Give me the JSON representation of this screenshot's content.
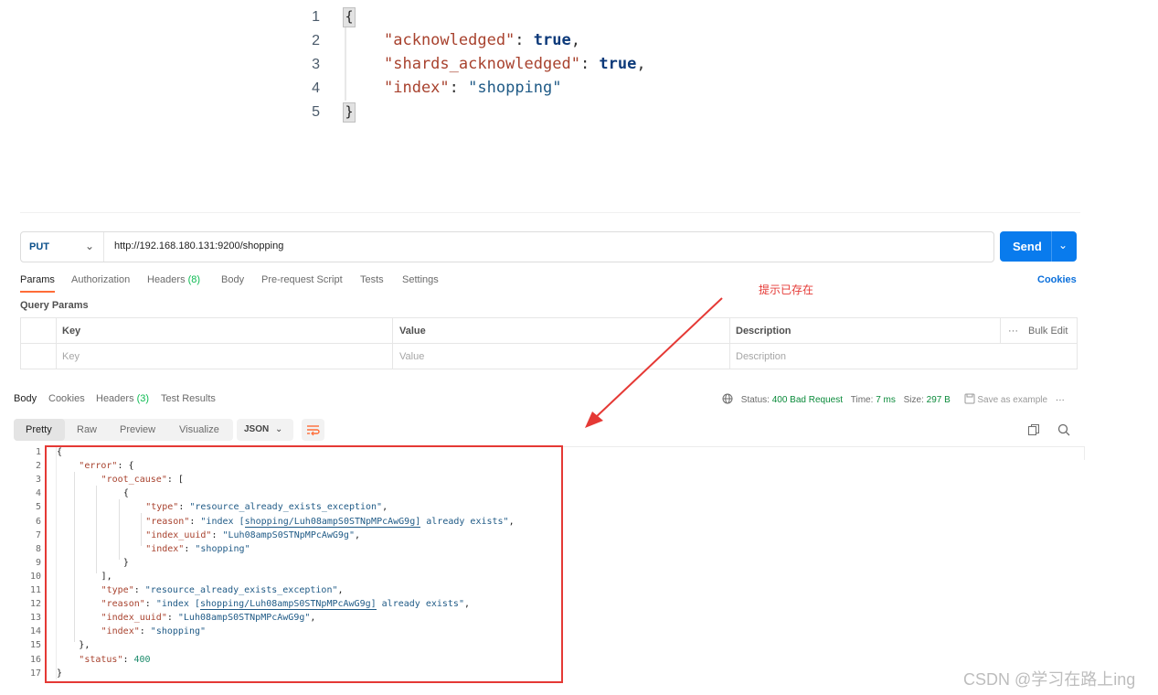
{
  "snippet": {
    "line_numbers": [
      "1",
      "2",
      "3",
      "4",
      "5"
    ],
    "open_brace": "{",
    "close_brace": "}",
    "lines": [
      {
        "key": "\"acknowledged\"",
        "sep": ": ",
        "value": "true",
        "tail": ","
      },
      {
        "key": "\"shards_acknowledged\"",
        "sep": ": ",
        "value": "true",
        "tail": ","
      },
      {
        "key": "\"index\"",
        "sep": ": ",
        "value": "\"shopping\"",
        "tail": ""
      }
    ]
  },
  "request": {
    "method": "PUT",
    "url": "http://192.168.180.131:9200/shopping",
    "send_label": "Send",
    "tabs": [
      "Params",
      "Authorization",
      "Headers",
      "(8)",
      "Body",
      "Pre-request Script",
      "Tests",
      "Settings"
    ],
    "cookies_label": "Cookies",
    "query_params_title": "Query Params",
    "table": {
      "headers": [
        "Key",
        "Value",
        "Description"
      ],
      "bulk_edit": "Bulk Edit",
      "placeholders": [
        "Key",
        "Value",
        "Description"
      ]
    }
  },
  "annotation": "提示已存在",
  "response": {
    "tabs": [
      "Body",
      "Cookies",
      "Headers",
      "(3)",
      "Test Results"
    ],
    "status_label": "Status:",
    "status_value": "400 Bad Request",
    "time_label": "Time:",
    "time_value": "7 ms",
    "size_label": "Size:",
    "size_value": "297 B",
    "save_example": "Save as example",
    "view_tabs": [
      "Pretty",
      "Raw",
      "Preview",
      "Visualize"
    ],
    "format": "JSON",
    "line_numbers": [
      "1",
      "2",
      "3",
      "4",
      "5",
      "6",
      "7",
      "8",
      "9",
      "10",
      "11",
      "12",
      "13",
      "14",
      "15",
      "16",
      "17"
    ],
    "code_lines": [
      [
        {
          "c": "p",
          "t": "{"
        }
      ],
      [
        {
          "c": "key",
          "t": "\"error\""
        },
        {
          "c": "p",
          "t": ": {"
        }
      ],
      [
        {
          "c": "key",
          "t": "\"root_cause\""
        },
        {
          "c": "p",
          "t": ": ["
        }
      ],
      [
        {
          "c": "p",
          "t": "{"
        }
      ],
      [
        {
          "c": "key",
          "t": "\"type\""
        },
        {
          "c": "p",
          "t": ": "
        },
        {
          "c": "str",
          "t": "\"resource_already_exists_exception\""
        },
        {
          "c": "p",
          "t": ","
        }
      ],
      [
        {
          "c": "key",
          "t": "\"reason\""
        },
        {
          "c": "p",
          "t": ": "
        },
        {
          "c": "str",
          "t": "\"index ["
        },
        {
          "c": "str ul",
          "t": "shopping/Luh08ampS0STNpMPcAwG9g]"
        },
        {
          "c": "str",
          "t": " already exists\""
        },
        {
          "c": "p",
          "t": ","
        }
      ],
      [
        {
          "c": "key",
          "t": "\"index_uuid\""
        },
        {
          "c": "p",
          "t": ": "
        },
        {
          "c": "str",
          "t": "\"Luh08ampS0STNpMPcAwG9g\""
        },
        {
          "c": "p",
          "t": ","
        }
      ],
      [
        {
          "c": "key",
          "t": "\"index\""
        },
        {
          "c": "p",
          "t": ": "
        },
        {
          "c": "str",
          "t": "\"shopping\""
        }
      ],
      [
        {
          "c": "p",
          "t": "}"
        }
      ],
      [
        {
          "c": "p",
          "t": "],"
        }
      ],
      [
        {
          "c": "key",
          "t": "\"type\""
        },
        {
          "c": "p",
          "t": ": "
        },
        {
          "c": "str",
          "t": "\"resource_already_exists_exception\""
        },
        {
          "c": "p",
          "t": ","
        }
      ],
      [
        {
          "c": "key",
          "t": "\"reason\""
        },
        {
          "c": "p",
          "t": ": "
        },
        {
          "c": "str",
          "t": "\"index ["
        },
        {
          "c": "str ul",
          "t": "shopping/Luh08ampS0STNpMPcAwG9g]"
        },
        {
          "c": "str",
          "t": " already exists\""
        },
        {
          "c": "p",
          "t": ","
        }
      ],
      [
        {
          "c": "key",
          "t": "\"index_uuid\""
        },
        {
          "c": "p",
          "t": ": "
        },
        {
          "c": "str",
          "t": "\"Luh08ampS0STNpMPcAwG9g\""
        },
        {
          "c": "p",
          "t": ","
        }
      ],
      [
        {
          "c": "key",
          "t": "\"index\""
        },
        {
          "c": "p",
          "t": ": "
        },
        {
          "c": "str",
          "t": "\"shopping\""
        }
      ],
      [
        {
          "c": "p",
          "t": "},"
        }
      ],
      [
        {
          "c": "key",
          "t": "\"status\""
        },
        {
          "c": "p",
          "t": ": "
        },
        {
          "c": "numv",
          "t": "400"
        }
      ],
      [
        {
          "c": "p",
          "t": "}"
        }
      ]
    ]
  },
  "watermark": "CSDN @学习在路上ing",
  "colors": {
    "send": "#097bed",
    "accent": "#ff6c37",
    "highlight": "#e53935"
  },
  "icons": [
    "chevron-down-icon",
    "globe-icon",
    "save-icon",
    "more-icon",
    "wrap-icon",
    "copy-icon",
    "search-icon"
  ]
}
